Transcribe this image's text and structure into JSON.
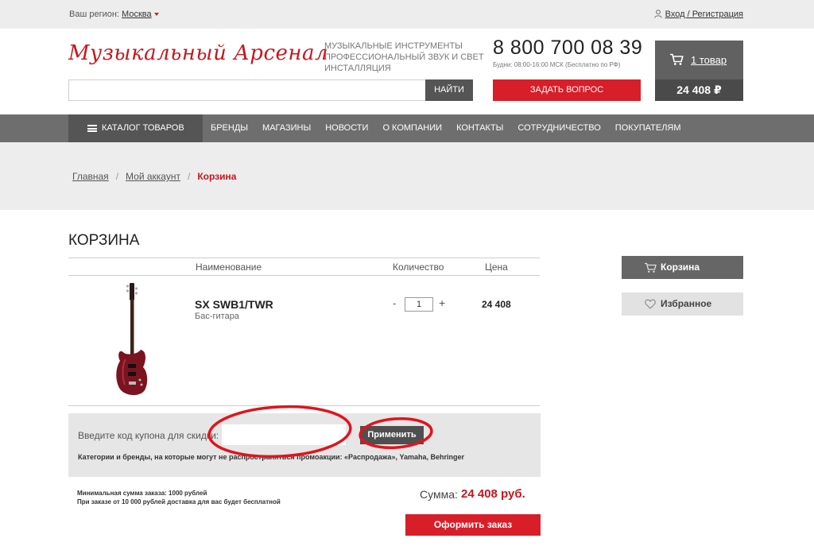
{
  "topbar": {
    "region_label": "Ваш регион:",
    "region_city": "Москва",
    "login": "Вход / Регистрация"
  },
  "header": {
    "logo": "Музыкальный Арсенал",
    "tagline": [
      "МУЗЫКАЛЬНЫЕ ИНСТРУМЕНТЫ",
      "ПРОФЕССИОНАЛЬНЫЙ ЗВУК И СВЕТ",
      "ИНСТАЛЛЯЦИЯ"
    ],
    "phone": "8 800 700 08 39",
    "hours": "Будни: 08:00-16:00 МСК (Бесплатно по РФ)",
    "ask_button": "ЗАДАТЬ ВОПРОС",
    "search_button": "НАЙТИ",
    "search_value": "",
    "cart_count": "1 товар",
    "cart_sum": "24 408 ₽"
  },
  "nav": {
    "catalog": "КАТАЛОГ ТОВАРОВ",
    "items": [
      "БРЕНДЫ",
      "МАГАЗИНЫ",
      "НОВОСТИ",
      "О КОМПАНИИ",
      "КОНТАКТЫ",
      "СОТРУДНИЧЕСТВО",
      "ПОКУПАТЕЛЯМ"
    ]
  },
  "breadcrumbs": {
    "items": [
      "Главная",
      "Мой аккаунт"
    ],
    "current": "Корзина",
    "separator": "/"
  },
  "cart": {
    "title": "КОРЗИНА",
    "columns": {
      "name": "Наименование",
      "qty": "Количество",
      "price": "Цена"
    },
    "item": {
      "name": "SX SWB1/TWR",
      "type": "Бас-гитара",
      "qty": "1",
      "price": "24 408",
      "minus": "-",
      "plus": "+"
    },
    "coupon": {
      "label": "Введите код купона для скидки:",
      "value": "",
      "apply": "Применить",
      "note": "Категории и бренды, на которые могут не распространяться промоакции: «Распродажа», Yamaha, Behringer"
    },
    "min_sum": "Минимальная сумма заказа: 1000 рублей",
    "free_delivery": "При заказе от 10 000 рублей доставка для вас будет бесплатной",
    "sum_label": "Сумма:",
    "sum_value": "24 408 руб.",
    "order_button": "Оформить заказ"
  },
  "sidebar": {
    "cart": "Корзина",
    "favorites": "Избранное"
  },
  "colors": {
    "brand_red": "#d81e28",
    "dark_gray": "#555555",
    "nav_gray": "#6e6e6e",
    "light_gray": "#ededed",
    "annotation_red": "#e0141c"
  },
  "icons": [
    "user-icon",
    "cart-icon",
    "menu-icon",
    "heart-icon",
    "caret-down-icon"
  ]
}
